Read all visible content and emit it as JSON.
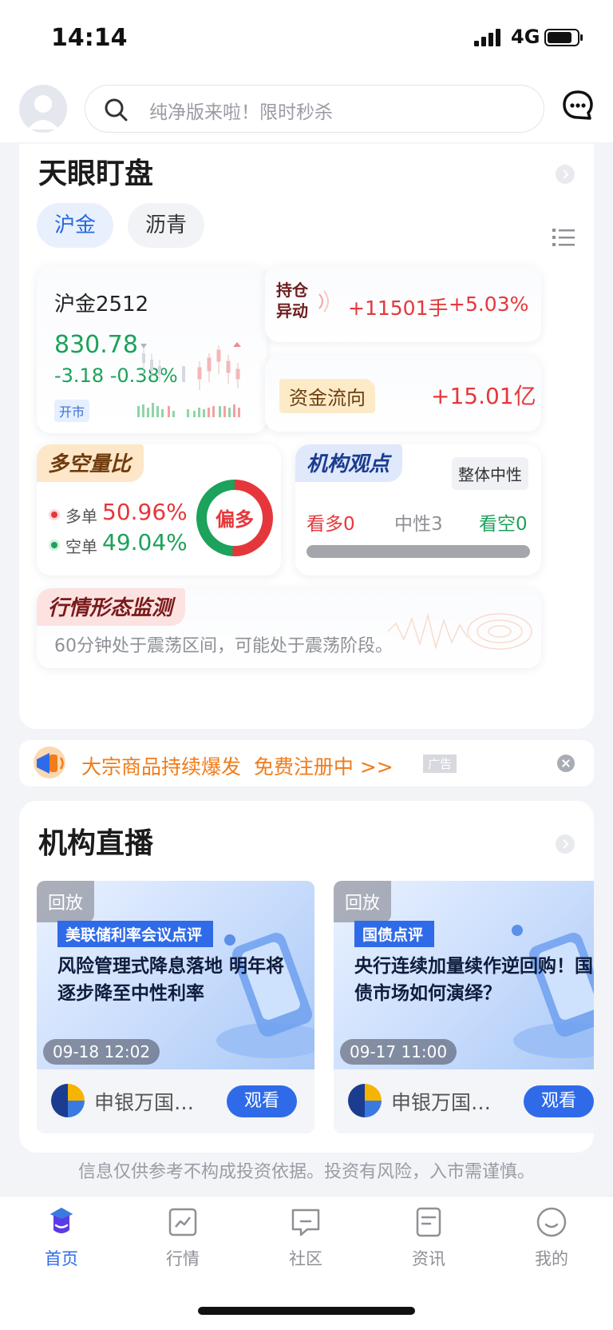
{
  "status_bar": {
    "time": "14:14",
    "network": "4G"
  },
  "search": {
    "placeholder": "纯净版来啦！限时秒杀"
  },
  "watch_section": {
    "title": "天眼盯盘",
    "tabs": [
      {
        "label": "沪金",
        "active": true
      },
      {
        "label": "沥青",
        "active": false
      }
    ],
    "quote": {
      "contract": "沪金2512",
      "price": "830.78",
      "change": "-3.18",
      "change_pct": "-0.38%",
      "status": "开市"
    },
    "position_change": {
      "label_line1": "持仓",
      "label_line2": "异动",
      "lots": "+11501手",
      "pct": "+5.03%"
    },
    "fund_flow": {
      "label": "资金流向",
      "value": "+15.01亿"
    },
    "long_short": {
      "label": "多空量比",
      "long_label": "多单",
      "long_value": "50.96%",
      "short_label": "空单",
      "short_value": "49.04%",
      "bias": "偏多",
      "long_ratio": 0.5096
    },
    "institution": {
      "label": "机构观点",
      "overall": "整体中性",
      "bullish": "看多0",
      "neutral": "中性3",
      "bearish": "看空0"
    },
    "pattern": {
      "label": "行情形态监测",
      "text": "60分钟处于震荡区间，可能处于震荡阶段。"
    }
  },
  "ad": {
    "text": "大宗商品持续爆发  免费注册中 >>",
    "tag": "广告"
  },
  "live_section": {
    "title": "机构直播",
    "items": [
      {
        "badge": "回放",
        "topic": "美联储利率会议点评",
        "headline": "风险管理式降息落地 明年将逐步降至中性利率",
        "time": "09-18 12:02",
        "org": "申银万国…",
        "action": "观看"
      },
      {
        "badge": "回放",
        "topic": "国债点评",
        "headline": "央行连续加量续作逆回购！国债市场如何演绎？",
        "time": "09-17 11:00",
        "org": "申银万国…",
        "action": "观看"
      }
    ]
  },
  "disclaimer": "信息仅供参考不构成投资依据。投资有风险，入市需谨慎。",
  "tab_bar": [
    {
      "label": "首页",
      "icon": "home-icon",
      "active": true
    },
    {
      "label": "行情",
      "icon": "chart-icon",
      "active": false
    },
    {
      "label": "社区",
      "icon": "community-icon",
      "active": false
    },
    {
      "label": "资讯",
      "icon": "news-icon",
      "active": false
    },
    {
      "label": "我的",
      "icon": "profile-icon",
      "active": false
    }
  ],
  "colors": {
    "accent": "#2f6be8",
    "up": "#e5373b",
    "down": "#1ca25a"
  }
}
